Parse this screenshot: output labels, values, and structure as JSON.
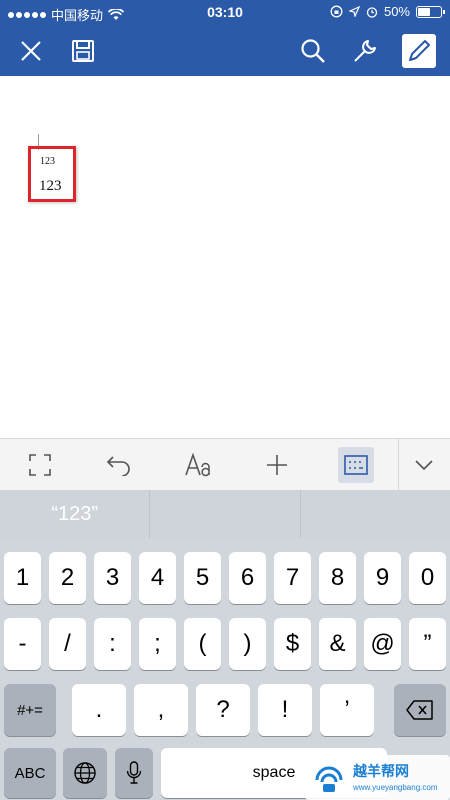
{
  "status_bar": {
    "carrier": "中国移动",
    "time": "03:10",
    "battery": "50%",
    "battery_level": 0.5
  },
  "toolbar": {
    "close_icon": "close-icon",
    "save_icon": "save-icon",
    "search_icon": "search-icon",
    "tools_icon": "wrench-icon",
    "edit_icon": "pencil-icon",
    "accent_color": "#2b5aa8"
  },
  "document": {
    "small_text": "123",
    "main_text": "123",
    "highlight_color": "#e0242b"
  },
  "accessory_bar": {
    "items": [
      "expand-icon",
      "undo-icon",
      "font-format-icon",
      "insert-icon",
      "keyboard-mode-icon",
      "hide-keyboard-icon"
    ]
  },
  "suggestions": [
    "“123”",
    "",
    ""
  ],
  "keyboard": {
    "row1": [
      "1",
      "2",
      "3",
      "4",
      "5",
      "6",
      "7",
      "8",
      "9",
      "0"
    ],
    "row2": [
      "-",
      "/",
      ":",
      ";",
      "(",
      ")",
      "$",
      "&",
      "@",
      "”"
    ],
    "row3_left": "#+=",
    "row3": [
      ".",
      ",",
      "?",
      "!",
      "’"
    ],
    "abc": "ABC",
    "space": "space"
  },
  "watermark": {
    "title": "越羊帮网",
    "url": "www.yueyangbang.com"
  }
}
